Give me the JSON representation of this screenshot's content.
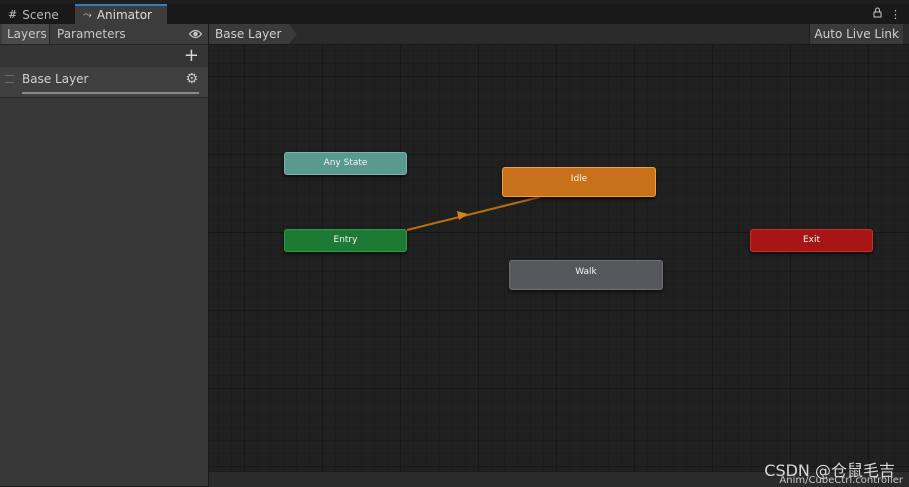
{
  "tabs": [
    {
      "label": "Scene",
      "icon": "grid-icon"
    },
    {
      "label": "Animator",
      "icon": "animator-icon"
    }
  ],
  "window_controls": {
    "lock": "lock-icon",
    "menu": "kebab-menu-icon"
  },
  "left_panel": {
    "tabs": [
      "Layers",
      "Parameters"
    ],
    "add_label": "+",
    "layers": [
      {
        "name": "Base Layer"
      }
    ]
  },
  "graph": {
    "breadcrumb": "Base Layer",
    "auto_live_link": "Auto Live Link",
    "states": {
      "any_state": "Any State",
      "entry": "Entry",
      "idle": "Idle",
      "walk": "Walk",
      "exit": "Exit"
    },
    "controller_path": "Anim/CubeCtrl.controller"
  },
  "watermark": "CSDN @仓鼠毛吉",
  "colors": {
    "any_state": "#5a9a8e",
    "entry": "#1c7a34",
    "idle_default": "#c9711a",
    "walk": "#55575b",
    "exit": "#a81515",
    "transition": "#b56e14",
    "tab_accent": "#3a79bb"
  }
}
